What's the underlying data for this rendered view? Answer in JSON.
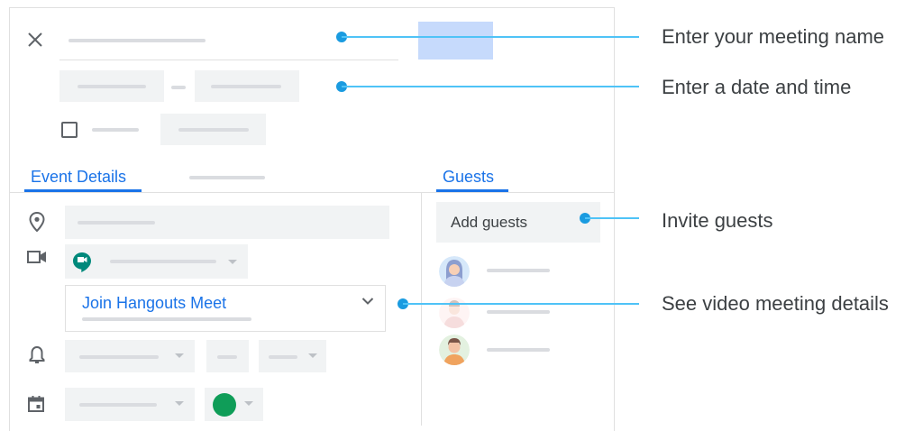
{
  "tabs": {
    "event_details": "Event Details",
    "guests": "Guests"
  },
  "guests": {
    "add_placeholder": "Add guests"
  },
  "conference": {
    "join_label": "Join Hangouts Meet"
  },
  "callouts": {
    "meeting_name": "Enter your meeting name",
    "date_time": "Enter a date and time",
    "invite_guests": "Invite guests",
    "video_details": "See video meeting details"
  },
  "colors": {
    "accent": "#1a73e8",
    "callout_line": "#4fc3f7",
    "callout_dot": "#1a9be0",
    "meet_green": "#00897b",
    "event_color": "#0f9d58",
    "save_button": "#c6dafc"
  },
  "icons": [
    "close-icon",
    "location-pin-icon",
    "video-camera-icon",
    "hangouts-meet-icon",
    "chevron-down-icon",
    "bell-icon",
    "calendar-icon"
  ]
}
